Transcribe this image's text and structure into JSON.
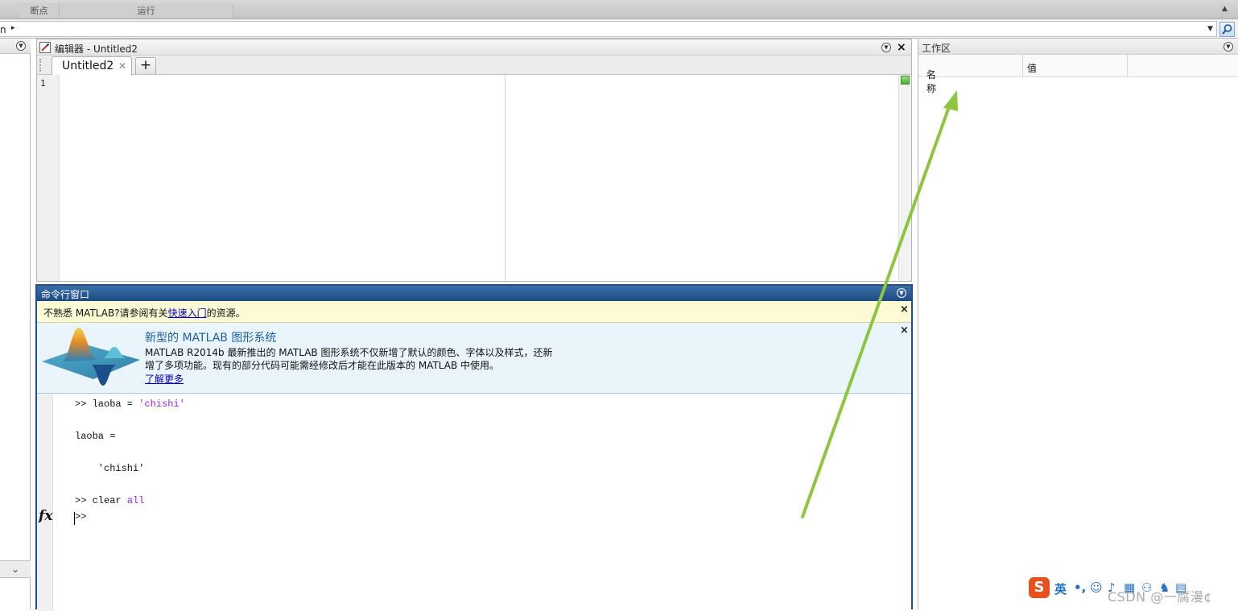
{
  "ribbon": {
    "sections": [
      "断点",
      "运行"
    ]
  },
  "address": {
    "path_text": "n",
    "separator": "▸"
  },
  "editor": {
    "title": "编辑器 - Untitled2",
    "tab_label": "Untitled2",
    "add_tab_label": "+",
    "line_number": "1"
  },
  "command_window": {
    "title": "命令行窗口",
    "tip": {
      "prefix": "不熟悉 MATLAB?请参阅有关",
      "link": "快速入门",
      "suffix": "的资源。"
    },
    "news": {
      "title": "新型的 MATLAB 图形系统",
      "body_line1": "MATLAB R2014b 最新推出的 MATLAB 图形系统不仅新增了默认的颜色、字体以及样式，还新",
      "body_line2": "增了多项功能。现有的部分代码可能需经修改后才能在此版本的 MATLAB 中使用。",
      "link": "了解更多"
    },
    "lines": {
      "l1_prompt": ">> laoba = ",
      "l1_string": "'chishi'",
      "l2": "laoba =",
      "l3": "    'chishi'",
      "l4_prompt": ">> clear ",
      "l4_kw": "all",
      "l5_prompt": ">> "
    },
    "fx_label": "fx"
  },
  "workspace": {
    "title": "工作区",
    "columns": [
      "名称",
      "值"
    ],
    "sort_indicator": "▲"
  },
  "ime": {
    "logo": "S",
    "mode": "英"
  },
  "watermark": "CSDN @一腐漫¢",
  "colors": {
    "command_title_bg": "#1d4a82",
    "tip_bg": "#fdfbd5",
    "news_bg": "#eaf4fb",
    "keyword": "#a020f0",
    "arrow": "#8cc63f"
  }
}
